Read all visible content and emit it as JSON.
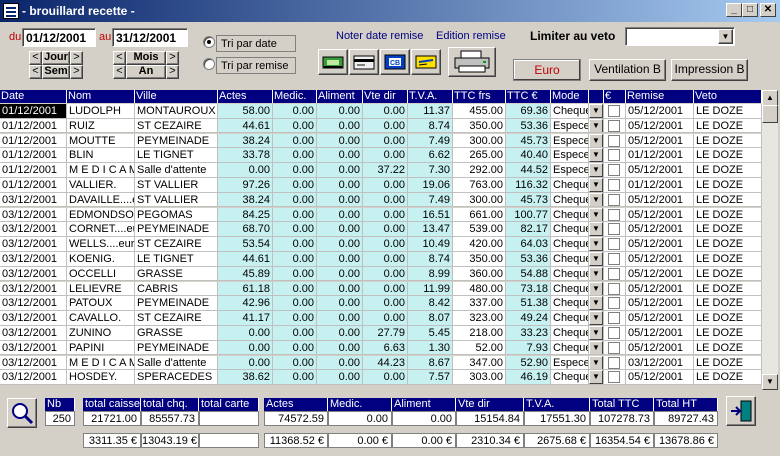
{
  "window": {
    "title": "- brouillard recette -",
    "min": "_",
    "max": "□",
    "close": "✕"
  },
  "filters": {
    "du_label": "du",
    "du_value": "01/12/2001",
    "au_label": "au",
    "au_value": "31/12/2001",
    "jour": "Jour",
    "sem": "Sem",
    "mois": "Mois",
    "an": "An",
    "prev": "<",
    "next": ">",
    "tri_date": "Tri par date",
    "tri_remise": "Tri par remise",
    "noter": "Noter date remise",
    "edition": "Edition remise",
    "limiter": "Limiter au veto",
    "limiter_value": "",
    "euro": "Euro",
    "ventilation": "Ventilation B",
    "impression": "Impression B"
  },
  "grid": {
    "headers": [
      "Date",
      "Nom",
      "Ville",
      "Actes",
      "Medic.",
      "Aliment",
      "Vte dir",
      "T.V.A.",
      "TTC frs",
      "TTC €",
      "Mode",
      "",
      "€",
      "Remise",
      "Veto"
    ],
    "rows": [
      [
        "01/12/2001",
        "LUDOLPH",
        "MONTAUROUX",
        "58.00",
        "0.00",
        "0.00",
        "0.00",
        "11.37",
        "455.00",
        "69.36",
        "Cheque",
        "05/12/2001",
        "LE DOZE"
      ],
      [
        "01/12/2001",
        "RUIZ",
        "ST CEZAIRE",
        "44.61",
        "0.00",
        "0.00",
        "0.00",
        "8.74",
        "350.00",
        "53.36",
        "Especes",
        "05/12/2001",
        "LE DOZE"
      ],
      [
        "01/12/2001",
        "MOUTTE",
        "PEYMEINADE",
        "38.24",
        "0.00",
        "0.00",
        "0.00",
        "7.49",
        "300.00",
        "45.73",
        "Especes",
        "05/12/2001",
        "LE DOZE"
      ],
      [
        "01/12/2001",
        "BLIN",
        "LE TIGNET",
        "33.78",
        "0.00",
        "0.00",
        "0.00",
        "6.62",
        "265.00",
        "40.40",
        "Especes",
        "01/12/2001",
        "LE DOZE"
      ],
      [
        "01/12/2001",
        "M E D I C A M",
        "Salle d'attente",
        "0.00",
        "0.00",
        "0.00",
        "37.22",
        "7.30",
        "292.00",
        "44.52",
        "Especes",
        "05/12/2001",
        "LE DOZE"
      ],
      [
        "01/12/2001",
        "VALLIER.",
        "ST VALLIER",
        "97.26",
        "0.00",
        "0.00",
        "0.00",
        "19.06",
        "763.00",
        "116.32",
        "Cheque",
        "01/12/2001",
        "LE DOZE"
      ],
      [
        "03/12/2001",
        "DAVAILLE....eu",
        "ST VALLIER",
        "38.24",
        "0.00",
        "0.00",
        "0.00",
        "7.49",
        "300.00",
        "45.73",
        "Cheque",
        "05/12/2001",
        "LE DOZE"
      ],
      [
        "03/12/2001",
        "EDMONDSON",
        "PEGOMAS",
        "84.25",
        "0.00",
        "0.00",
        "0.00",
        "16.51",
        "661.00",
        "100.77",
        "Cheque",
        "05/12/2001",
        "LE DOZE"
      ],
      [
        "03/12/2001",
        "CORNET....eu",
        "PEYMEINADE",
        "68.70",
        "0.00",
        "0.00",
        "0.00",
        "13.47",
        "539.00",
        "82.17",
        "Cheque",
        "05/12/2001",
        "LE DOZE"
      ],
      [
        "03/12/2001",
        "WELLS....euro",
        "ST CEZAIRE",
        "53.54",
        "0.00",
        "0.00",
        "0.00",
        "10.49",
        "420.00",
        "64.03",
        "Cheque",
        "05/12/2001",
        "LE DOZE"
      ],
      [
        "03/12/2001",
        "KOENIG.",
        "LE TIGNET",
        "44.61",
        "0.00",
        "0.00",
        "0.00",
        "8.74",
        "350.00",
        "53.36",
        "Cheque",
        "05/12/2001",
        "LE DOZE"
      ],
      [
        "03/12/2001",
        "OCCELLI",
        "GRASSE",
        "45.89",
        "0.00",
        "0.00",
        "0.00",
        "8.99",
        "360.00",
        "54.88",
        "Cheque",
        "05/12/2001",
        "LE DOZE"
      ],
      [
        "03/12/2001",
        "LELIEVRE",
        "CABRIS",
        "61.18",
        "0.00",
        "0.00",
        "0.00",
        "11.99",
        "480.00",
        "73.18",
        "Cheque",
        "05/12/2001",
        "LE DOZE"
      ],
      [
        "03/12/2001",
        "PATOUX",
        "PEYMEINADE",
        "42.96",
        "0.00",
        "0.00",
        "0.00",
        "8.42",
        "337.00",
        "51.38",
        "Cheque",
        "05/12/2001",
        "LE DOZE"
      ],
      [
        "03/12/2001",
        "CAVALLO.",
        "ST CEZAIRE",
        "41.17",
        "0.00",
        "0.00",
        "0.00",
        "8.07",
        "323.00",
        "49.24",
        "Cheque",
        "05/12/2001",
        "LE DOZE"
      ],
      [
        "03/12/2001",
        "ZUNINO",
        "GRASSE",
        "0.00",
        "0.00",
        "0.00",
        "27.79",
        "5.45",
        "218.00",
        "33.23",
        "Cheque",
        "05/12/2001",
        "LE DOZE"
      ],
      [
        "03/12/2001",
        "PAPINI",
        "PEYMEINADE",
        "0.00",
        "0.00",
        "0.00",
        "6.63",
        "1.30",
        "52.00",
        "7.93",
        "Cheque",
        "05/12/2001",
        "LE DOZE"
      ],
      [
        "03/12/2001",
        "M E D I C A M",
        "Salle d'attente",
        "0.00",
        "0.00",
        "0.00",
        "44.23",
        "8.67",
        "347.00",
        "52.90",
        "Especes",
        "03/12/2001",
        "LE DOZE"
      ],
      [
        "03/12/2001",
        "HOSDEY.",
        "SPERACEDES",
        "38.62",
        "0.00",
        "0.00",
        "0.00",
        "7.57",
        "303.00",
        "46.19",
        "Cheque",
        "05/12/2001",
        "LE DOZE"
      ]
    ]
  },
  "totals": {
    "nb_label": "Nb",
    "nb": "250",
    "total_caisse_label": "total caisse",
    "total_caisse": "21721.00",
    "total_chq_label": "total chq.",
    "total_chq": "85557.73",
    "total_carte_label": "total carte",
    "total_carte": "",
    "total_caisse_eur": "3311.35 €",
    "total_chq_eur": "13043.19 €",
    "total_carte_eur": "",
    "actes_label": "Actes",
    "actes": "74572.59",
    "actes_eur": "11368.52 €",
    "medic_label": "Medic.",
    "medic": "0.00",
    "medic_eur": "0.00 €",
    "aliment_label": "Aliment",
    "aliment": "0.00",
    "aliment_eur": "0.00 €",
    "vtedir_label": "Vte dir",
    "vtedir": "15154.84",
    "vtedir_eur": "2310.34 €",
    "tva_label": "T.V.A.",
    "tva": "17551.30",
    "tva_eur": "2675.68 €",
    "ttc_label": "Total TTC",
    "ttc": "107278.73",
    "ttc_eur": "16354.54 €",
    "ht_label": "Total HT",
    "ht": "89727.43",
    "ht_eur": "13678.86 €"
  }
}
